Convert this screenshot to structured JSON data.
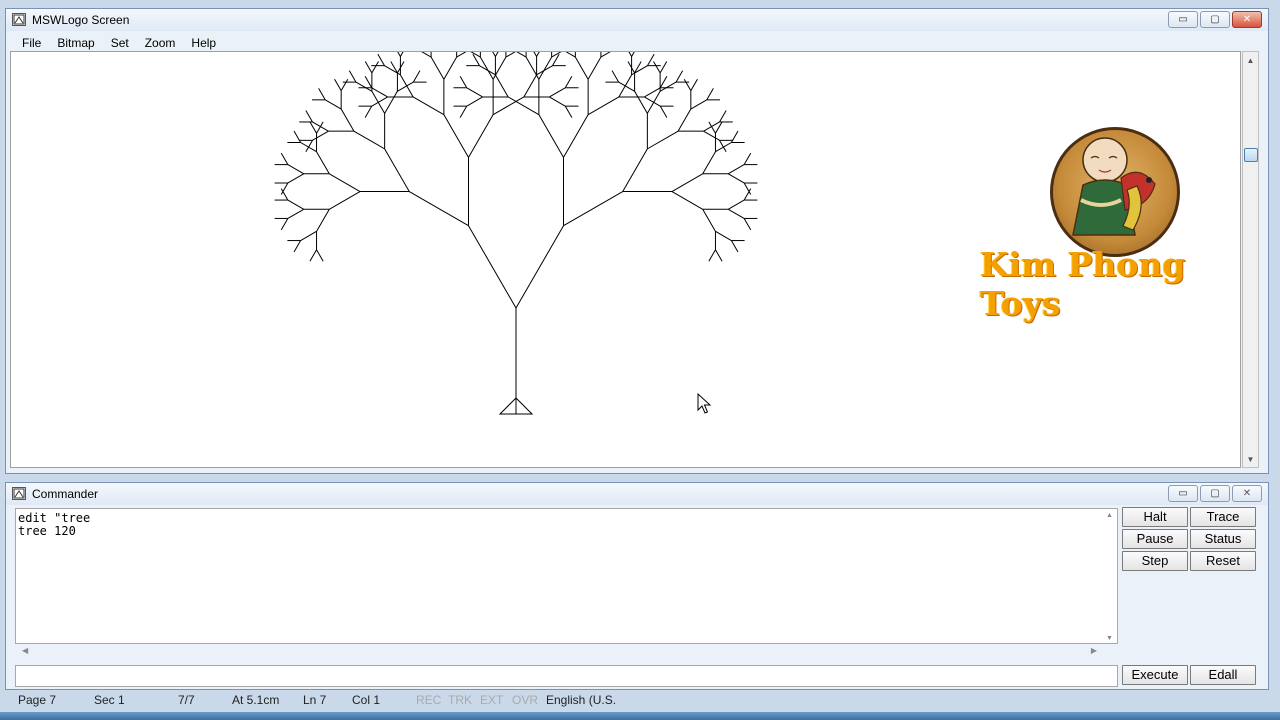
{
  "screen_window": {
    "title": "MSWLogo Screen",
    "menu": [
      "File",
      "Bitmap",
      "Set",
      "Zoom",
      "Help"
    ],
    "controls": {
      "minimize": "▭",
      "maximize": "▢",
      "close": "✕"
    }
  },
  "watermark": {
    "brand_text": "Kim Phong Toys",
    "brand_color": "#f5a000"
  },
  "commander_window": {
    "title": "Commander",
    "history_lines": [
      "edit \"tree",
      "tree 120"
    ],
    "input_value": "",
    "buttons": {
      "halt": "Halt",
      "trace": "Trace",
      "pause": "Pause",
      "status": "Status",
      "step": "Step",
      "reset": "Reset",
      "execute": "Execute",
      "edall": "Edall"
    }
  },
  "status_bar": {
    "page": "Page 7",
    "sec": "Sec 1",
    "pages": "7/7",
    "at": "At 5.1cm",
    "ln": "Ln 7",
    "col": "Col 1",
    "rec": "REC",
    "trk": "TRK",
    "ext": "EXT",
    "ovr": "OVR",
    "language": "English (U.S."
  },
  "drawing": {
    "trunk_length": 120,
    "recursion_depth": 7,
    "line_color": "#000000"
  }
}
